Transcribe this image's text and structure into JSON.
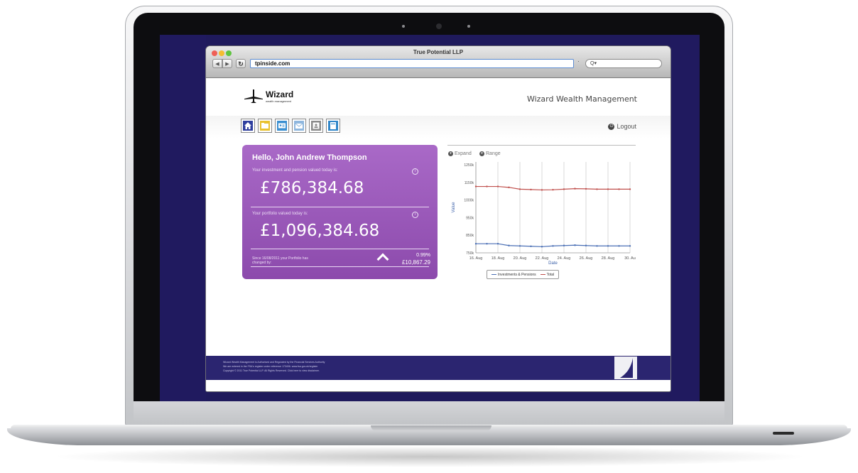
{
  "browser": {
    "window_title": "True Potential LLP",
    "url": "tpinside.com",
    "search_placeholder": "Q▾"
  },
  "site": {
    "logo_name": "Wizard",
    "logo_sub": "wealth management",
    "brand_title": "Wizard Wealth Management",
    "logout_label": "Logout",
    "nav_icons": [
      "home-icon",
      "folder-icon",
      "id-card-icon",
      "envelope-icon",
      "person-icon",
      "document-icon"
    ],
    "nav_colors": [
      "#2f3f9e",
      "#e9c230",
      "#3a8fd1",
      "#8fb7de",
      "#8a8a8a",
      "#2f86c9"
    ]
  },
  "card": {
    "greeting": "Hello, John Andrew Thompson",
    "investment_label": "Your investment and pension valued today is:",
    "investment_value": "£786,384.68",
    "portfolio_label": "Your portfolio valued today is:",
    "portfolio_value": "£1,096,384.68",
    "since_text": "Since 16/08/2011 your Portfolio has changed by:",
    "change_pct": "0.99%",
    "change_gbp": "£10,867.29",
    "bg_color": "#9a58b9"
  },
  "chart_controls": {
    "expand_label": "Expand",
    "range_label": "Range"
  },
  "chart_data": {
    "type": "line",
    "title": "",
    "xlabel": "Date",
    "ylabel": "Value",
    "x": [
      "16. Aug",
      "18. Aug",
      "20. Aug",
      "22. Aug",
      "24. Aug",
      "26. Aug",
      "28. Aug",
      "30. Au"
    ],
    "y_ticks": [
      "1250k",
      "1150k",
      "1000k",
      "950k",
      "850k",
      "750k"
    ],
    "ylim": [
      750,
      1250
    ],
    "series": [
      {
        "name": "Investments & Pensions",
        "color": "#4a6fb5",
        "values": [
          800,
          800,
          800,
          790,
          788,
          786,
          784,
          788,
          790,
          792,
          790,
          788,
          788,
          788,
          788
        ]
      },
      {
        "name": "Total",
        "color": "#c0504d",
        "values": [
          1115,
          1115,
          1115,
          1110,
          1100,
          1098,
          1096,
          1097,
          1100,
          1103,
          1102,
          1100,
          1100,
          1100,
          1100
        ]
      }
    ],
    "grid": true,
    "legend_position": "bottom"
  },
  "footer": {
    "line1": "Wizard Wealth Management is Authorised and Regulated by the Financial Services Authority",
    "line2": "We are entered in the FSA's register under reference 173406. www.fsa.gov.uk/register",
    "line3": "Copyright © 2011 True Potential LLP. All Rights Reserved. Click here to view disclaimer."
  }
}
